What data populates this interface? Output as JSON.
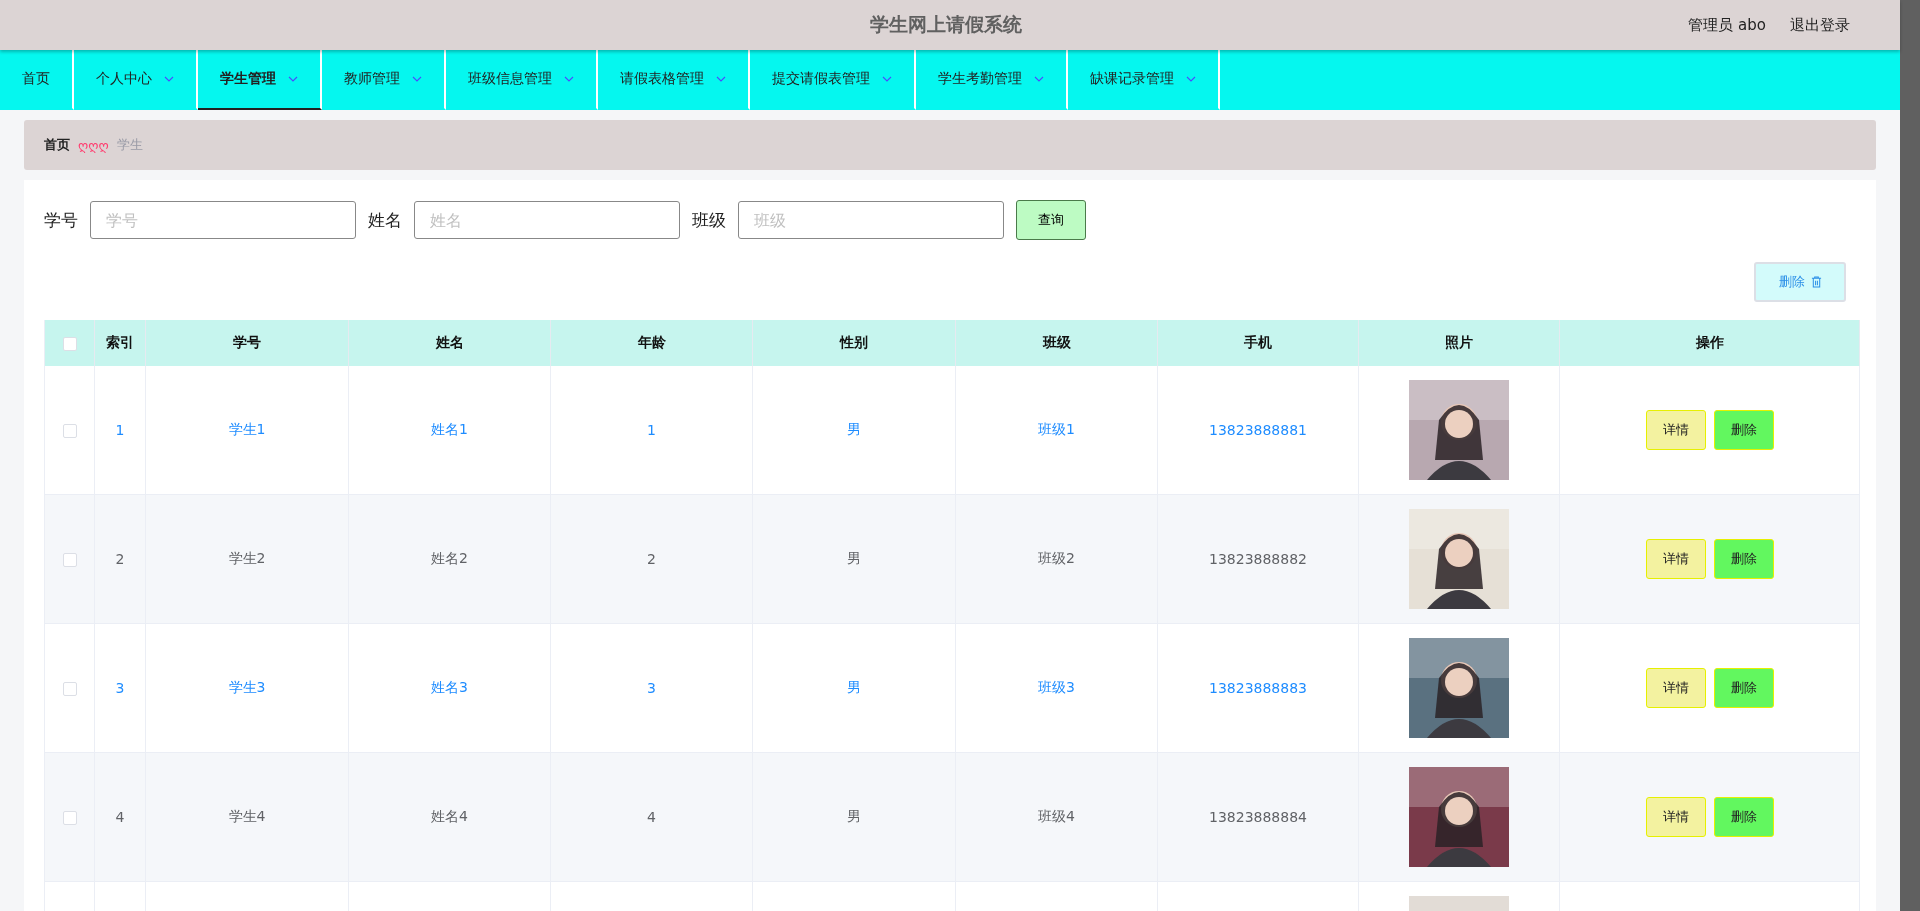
{
  "header": {
    "title": "学生网上请假系统",
    "user": "管理员 abo",
    "logout": "退出登录"
  },
  "nav": [
    {
      "label": "首页",
      "dropdown": false,
      "selected": false
    },
    {
      "label": "个人中心",
      "dropdown": true,
      "selected": false
    },
    {
      "label": "学生管理",
      "dropdown": true,
      "selected": true
    },
    {
      "label": "教师管理",
      "dropdown": true,
      "selected": false
    },
    {
      "label": "班级信息管理",
      "dropdown": true,
      "selected": false
    },
    {
      "label": "请假表格管理",
      "dropdown": true,
      "selected": false
    },
    {
      "label": "提交请假表管理",
      "dropdown": true,
      "selected": false
    },
    {
      "label": "学生考勤管理",
      "dropdown": true,
      "selected": false
    },
    {
      "label": "缺课记录管理",
      "dropdown": true,
      "selected": false
    }
  ],
  "breadcrumb": {
    "home": "首页",
    "separator": "ღღღ",
    "current": "学生"
  },
  "search": {
    "fields": [
      {
        "label": "学号",
        "placeholder": "学号"
      },
      {
        "label": "姓名",
        "placeholder": "姓名"
      },
      {
        "label": "班级",
        "placeholder": "班级"
      }
    ],
    "button": "查询"
  },
  "bulk_delete": "删除",
  "table": {
    "select_all": {
      "checked": false
    },
    "columns": [
      "索引",
      "学号",
      "姓名",
      "年龄",
      "性别",
      "班级",
      "手机",
      "照片",
      "操作"
    ],
    "rows": [
      {
        "checked": false,
        "highlighted": true,
        "striped": false,
        "cells": [
          "1",
          "学生1",
          "姓名1",
          "1",
          "男",
          "班级1",
          "13823888881"
        ],
        "photo": {
          "kind": "picture",
          "color": "#b8a8b0"
        },
        "actions": [
          "详情",
          "删除"
        ]
      },
      {
        "checked": false,
        "highlighted": false,
        "striped": true,
        "cells": [
          "2",
          "学生2",
          "姓名2",
          "2",
          "男",
          "班级2",
          "13823888882"
        ],
        "photo": {
          "kind": "picture",
          "color": "#e6e0d6"
        },
        "actions": [
          "详情",
          "删除"
        ]
      },
      {
        "checked": false,
        "highlighted": true,
        "striped": false,
        "cells": [
          "3",
          "学生3",
          "姓名3",
          "3",
          "男",
          "班级3",
          "13823888883"
        ],
        "photo": {
          "kind": "picture",
          "color": "#5a7180"
        },
        "actions": [
          "详情",
          "删除"
        ]
      },
      {
        "checked": false,
        "highlighted": false,
        "striped": true,
        "cells": [
          "4",
          "学生4",
          "姓名4",
          "4",
          "男",
          "班级4",
          "13823888884"
        ],
        "photo": {
          "kind": "picture",
          "color": "#7a3a4a"
        },
        "actions": [
          "详情",
          "删除"
        ]
      },
      {
        "photo": {
          "kind": "picture",
          "color": "#d8d0c8"
        }
      }
    ]
  }
}
